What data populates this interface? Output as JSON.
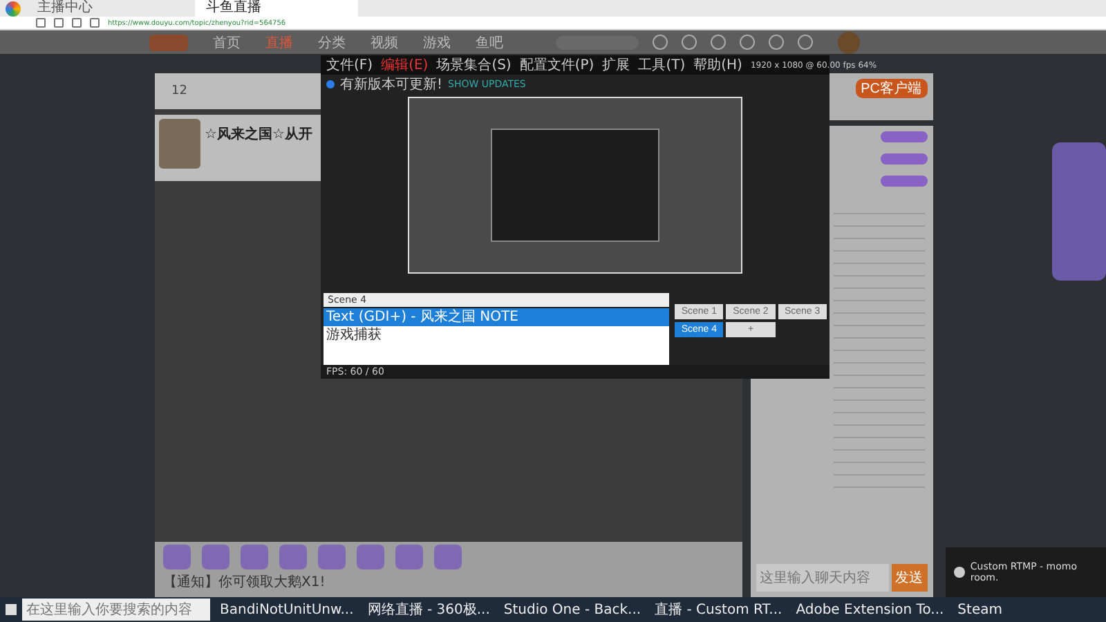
{
  "browser": {
    "tabs": [
      {
        "title": "主播中心",
        "selected": false
      },
      {
        "title": "斗鱼直播",
        "selected": true
      }
    ],
    "url": "https://www.douyu.com/topic/zhenyou?rid=564756"
  },
  "site": {
    "nav": [
      {
        "label": "首页",
        "selected": false
      },
      {
        "label": "直播",
        "selected": true
      },
      {
        "label": "分类",
        "selected": false
      },
      {
        "label": "视频",
        "selected": false
      },
      {
        "label": "游戏",
        "selected": false
      },
      {
        "label": "鱼吧",
        "selected": false
      }
    ],
    "stat_value": "12",
    "room_title": "☆风来之国☆从开",
    "client_button": "PC客户端",
    "notice": "【通知】你可领取大鹅X1!",
    "chat_placeholder": "这里输入聊天内容",
    "send_button": "发送"
  },
  "obs": {
    "menu": [
      {
        "label": "文件(F)",
        "selected": false
      },
      {
        "label": "编辑(E)",
        "selected": true
      },
      {
        "label": "场景集合(S)",
        "selected": false
      },
      {
        "label": "配置文件(P)",
        "selected": false
      },
      {
        "label": "扩展",
        "selected": false
      },
      {
        "label": "工具(T)",
        "selected": false
      },
      {
        "label": "帮助(H)",
        "selected": false
      }
    ],
    "resolution": "1920 x 1080 @ 60.00 fps 64%",
    "update_text": "有新版本可更新!",
    "update_link": "SHOW UPDATES",
    "scene_field": "Scene 4",
    "sources": [
      {
        "label": "Text (GDI+) - 风来之国 NOTE",
        "selected": true
      },
      {
        "label": "游戏捕获",
        "selected": false
      }
    ],
    "scenes": [
      {
        "label": "Scene 1",
        "selected": false
      },
      {
        "label": "Scene 2",
        "selected": false
      },
      {
        "label": "Scene 3",
        "selected": false
      },
      {
        "label": "Scene 4",
        "selected": true
      },
      {
        "label": "+",
        "selected": false
      }
    ],
    "fps": "FPS: 60 / 60"
  },
  "notification": {
    "text": "Custom RTMP - momo room."
  },
  "taskbar": {
    "search_placeholder": "在这里输入你要搜索的内容",
    "apps": [
      "BandiNotUnitUnw...",
      "网络直播 - 360极...",
      "Studio One - Back...",
      "直播 - Custom RT...",
      "Adobe Extension To...",
      "Steam"
    ]
  }
}
